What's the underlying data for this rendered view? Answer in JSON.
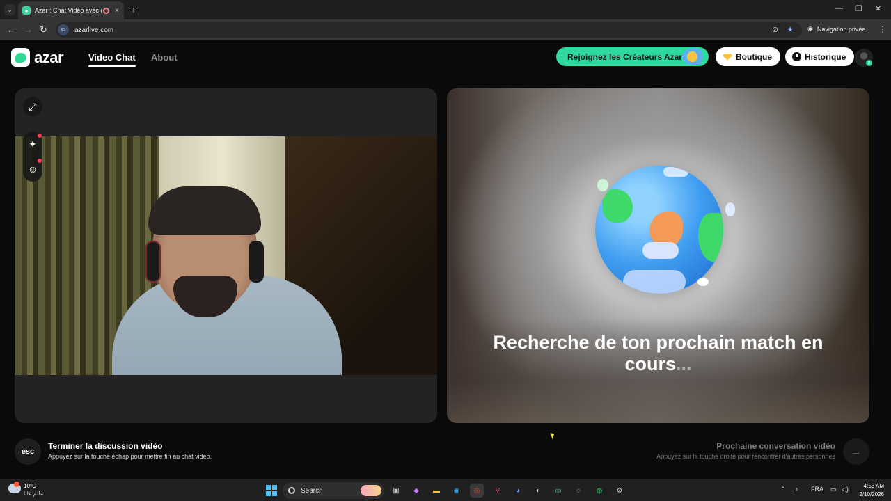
{
  "browser": {
    "tab_title": "Azar : Chat Vidéo avec de n",
    "tab_close": "×",
    "new_tab": "+",
    "url": "azarlive.com",
    "incognito_label": "Navigation privée",
    "window_controls": [
      "—",
      "❐",
      "✕"
    ]
  },
  "header": {
    "logo_text": "azar",
    "nav": [
      {
        "label": "Video Chat",
        "active": true
      },
      {
        "label": "About",
        "active": false
      }
    ],
    "creators_button": "Rejoignez les Créateurs Azar",
    "shop_button": "Boutique",
    "history_button": "Historique",
    "avatar_badge": "8"
  },
  "search_status": {
    "text": "Recherche de ton prochain match en cours",
    "dots": "..."
  },
  "controls": {
    "esc_key": "esc",
    "end_title": "Terminer la discussion vidéo",
    "end_subtitle": "Appuyez sur la touche échap pour mettre fin au chat vidéo.",
    "next_title": "Prochaine conversation vidéo",
    "next_subtitle": "Appuyez sur la touche droite pour rencontrer d'autres personnes",
    "next_arrow": "→"
  },
  "taskbar": {
    "weather_temp": "10°C",
    "weather_location": "عالم غانا",
    "search_label": "Search",
    "language": "FRA",
    "time": "4:53 AM",
    "date": "2/10/2026"
  },
  "colors": {
    "accent_green": "#2ed89e",
    "notification_red": "#ff3b5c"
  }
}
